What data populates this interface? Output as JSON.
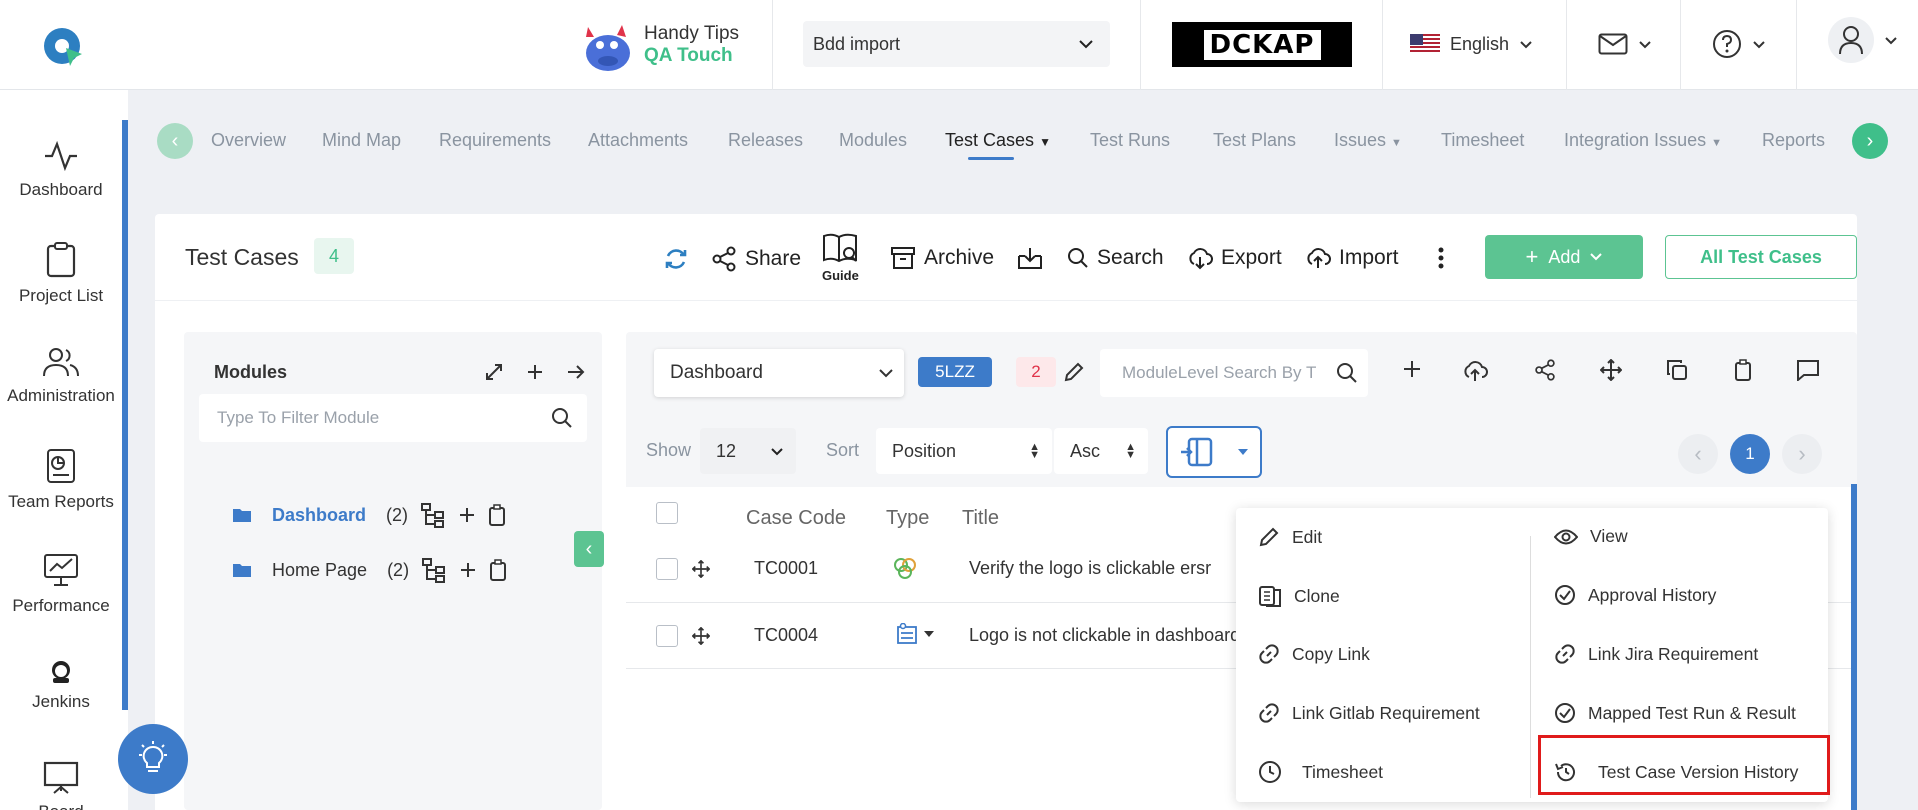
{
  "header": {
    "promo_title": "Handy Tips",
    "promo_subtitle": "QA Touch",
    "project_select": "Bdd import",
    "company_logo": "DCKAP",
    "language": "English"
  },
  "sidebar": {
    "items": [
      {
        "label": "Dashboard",
        "icon": "activity-icon"
      },
      {
        "label": "Project List",
        "icon": "clipboard-icon"
      },
      {
        "label": "Administration",
        "icon": "users-icon"
      },
      {
        "label": "Team Reports",
        "icon": "report-icon"
      },
      {
        "label": "Performance",
        "icon": "performance-icon"
      },
      {
        "label": "Jenkins",
        "icon": "jenkins-icon"
      },
      {
        "label": "Board",
        "icon": "board-icon"
      }
    ]
  },
  "tabs": {
    "items": [
      "Overview",
      "Mind Map",
      "Requirements",
      "Attachments",
      "Releases",
      "Modules",
      "Test Cases",
      "Test Runs",
      "Test Plans",
      "Issues",
      "Timesheet",
      "Integration Issues",
      "Reports"
    ],
    "active": "Test Cases"
  },
  "card": {
    "title": "Test Cases",
    "count": "4",
    "tools": {
      "share": "Share",
      "guide": "Guide",
      "archive": "Archive",
      "search": "Search",
      "export": "Export",
      "import": "Import"
    },
    "add_button": "Add",
    "all_button": "All Test Cases"
  },
  "modules": {
    "title": "Modules",
    "filter_placeholder": "Type To Filter Module",
    "items": [
      {
        "name": "Dashboard",
        "count": "(2)"
      },
      {
        "name": "Home Page",
        "count": "(2)"
      }
    ]
  },
  "panel": {
    "module_select": "Dashboard",
    "module_code": "5LZZ",
    "module_count": "2",
    "search_placeholder": "ModuleLevel Search By T",
    "show_label": "Show",
    "show_value": "12",
    "sort_label": "Sort",
    "sort_value": "Position",
    "order_value": "Asc",
    "page": "1",
    "columns": [
      "Case Code",
      "Type",
      "Title"
    ],
    "rows": [
      {
        "code": "TC0001",
        "title": "Verify the logo is clickable ersr"
      },
      {
        "code": "TC0004",
        "title": "Logo is not clickable in dashboard"
      }
    ]
  },
  "context_menu": {
    "left": [
      "Edit",
      "Clone",
      "Copy Link",
      "Link Gitlab Requirement",
      "Timesheet"
    ],
    "right": [
      "View",
      "Approval History",
      "Link Jira Requirement",
      "Mapped Test Run & Result",
      "Test Case Version History"
    ]
  },
  "colors": {
    "primary": "#3d7bc9",
    "accent_green": "#5cc492",
    "highlight_red": "#e01b1b"
  }
}
